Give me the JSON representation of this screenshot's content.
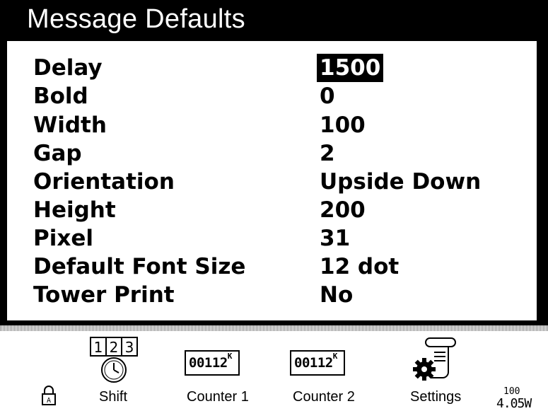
{
  "window": {
    "title": "Message Defaults"
  },
  "settings": [
    {
      "label": "Delay",
      "value": "1500",
      "selected": true
    },
    {
      "label": "Bold",
      "value": "0"
    },
    {
      "label": "Width",
      "value": "100"
    },
    {
      "label": "Gap",
      "value": "2"
    },
    {
      "label": "Orientation",
      "value": "Upside Down"
    },
    {
      "label": "Height",
      "value": "200"
    },
    {
      "label": "Pixel",
      "value": "31"
    },
    {
      "label": "Default Font Size",
      "value": "12 dot"
    },
    {
      "label": "Tower Print",
      "value": "No"
    }
  ],
  "toolbar": {
    "shift": {
      "label": "Shift",
      "icon": "shift-clock-icon",
      "digits": [
        "1",
        "2",
        "3"
      ]
    },
    "counter1": {
      "label": "Counter 1",
      "display": "00112",
      "suffix": "K"
    },
    "counter2": {
      "label": "Counter 2",
      "display": "00112",
      "suffix": "K"
    },
    "settings": {
      "label": "Settings",
      "icon": "settings-gear-icon"
    },
    "lock": {
      "icon": "lock-icon",
      "letter": "A"
    }
  },
  "status": {
    "top": "100",
    "bottom": "4.05W"
  },
  "colors": {
    "background": "#ffffff",
    "title_bar": "#000000",
    "selection": "#000000"
  }
}
